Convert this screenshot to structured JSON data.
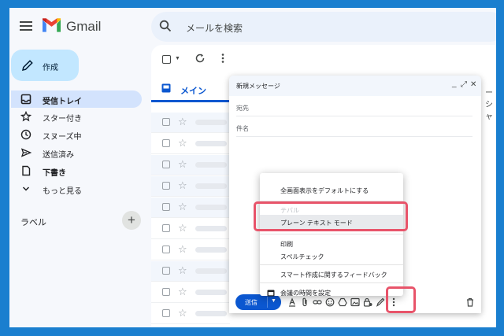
{
  "header": {
    "brand": "Gmail",
    "search_placeholder": "メールを検索"
  },
  "compose_button": {
    "label": "作成"
  },
  "nav": {
    "items": [
      {
        "label": "受信トレイ",
        "icon": "inbox-icon"
      },
      {
        "label": "スター付き",
        "icon": "star-icon"
      },
      {
        "label": "スヌーズ中",
        "icon": "clock-icon"
      },
      {
        "label": "送信済み",
        "icon": "send-icon"
      },
      {
        "label": "下書き",
        "icon": "draft-icon"
      },
      {
        "label": "もっと見る",
        "icon": "chevron-down-icon"
      }
    ],
    "labels_heading": "ラベル"
  },
  "main": {
    "tab_primary": "メイン",
    "tab_right_partial": "ーシャ"
  },
  "compose_window": {
    "title": "新規メッセージ",
    "to_label": "宛先",
    "subject_label": "件名",
    "send_label": "送信"
  },
  "menu": {
    "items": [
      {
        "label": "全画面表示をデフォルトにする"
      },
      {
        "label": "テバル"
      },
      {
        "label": "プレーン テキスト モード"
      },
      {
        "label": "印刷"
      },
      {
        "label": "スペルチェック"
      },
      {
        "label": "スマート作成に関するフィードバック"
      },
      {
        "label": "会議の時間を設定"
      }
    ]
  },
  "colors": {
    "accent": "#0b57d0",
    "highlight": "#e8546a",
    "frame": "#1a7fcf"
  }
}
